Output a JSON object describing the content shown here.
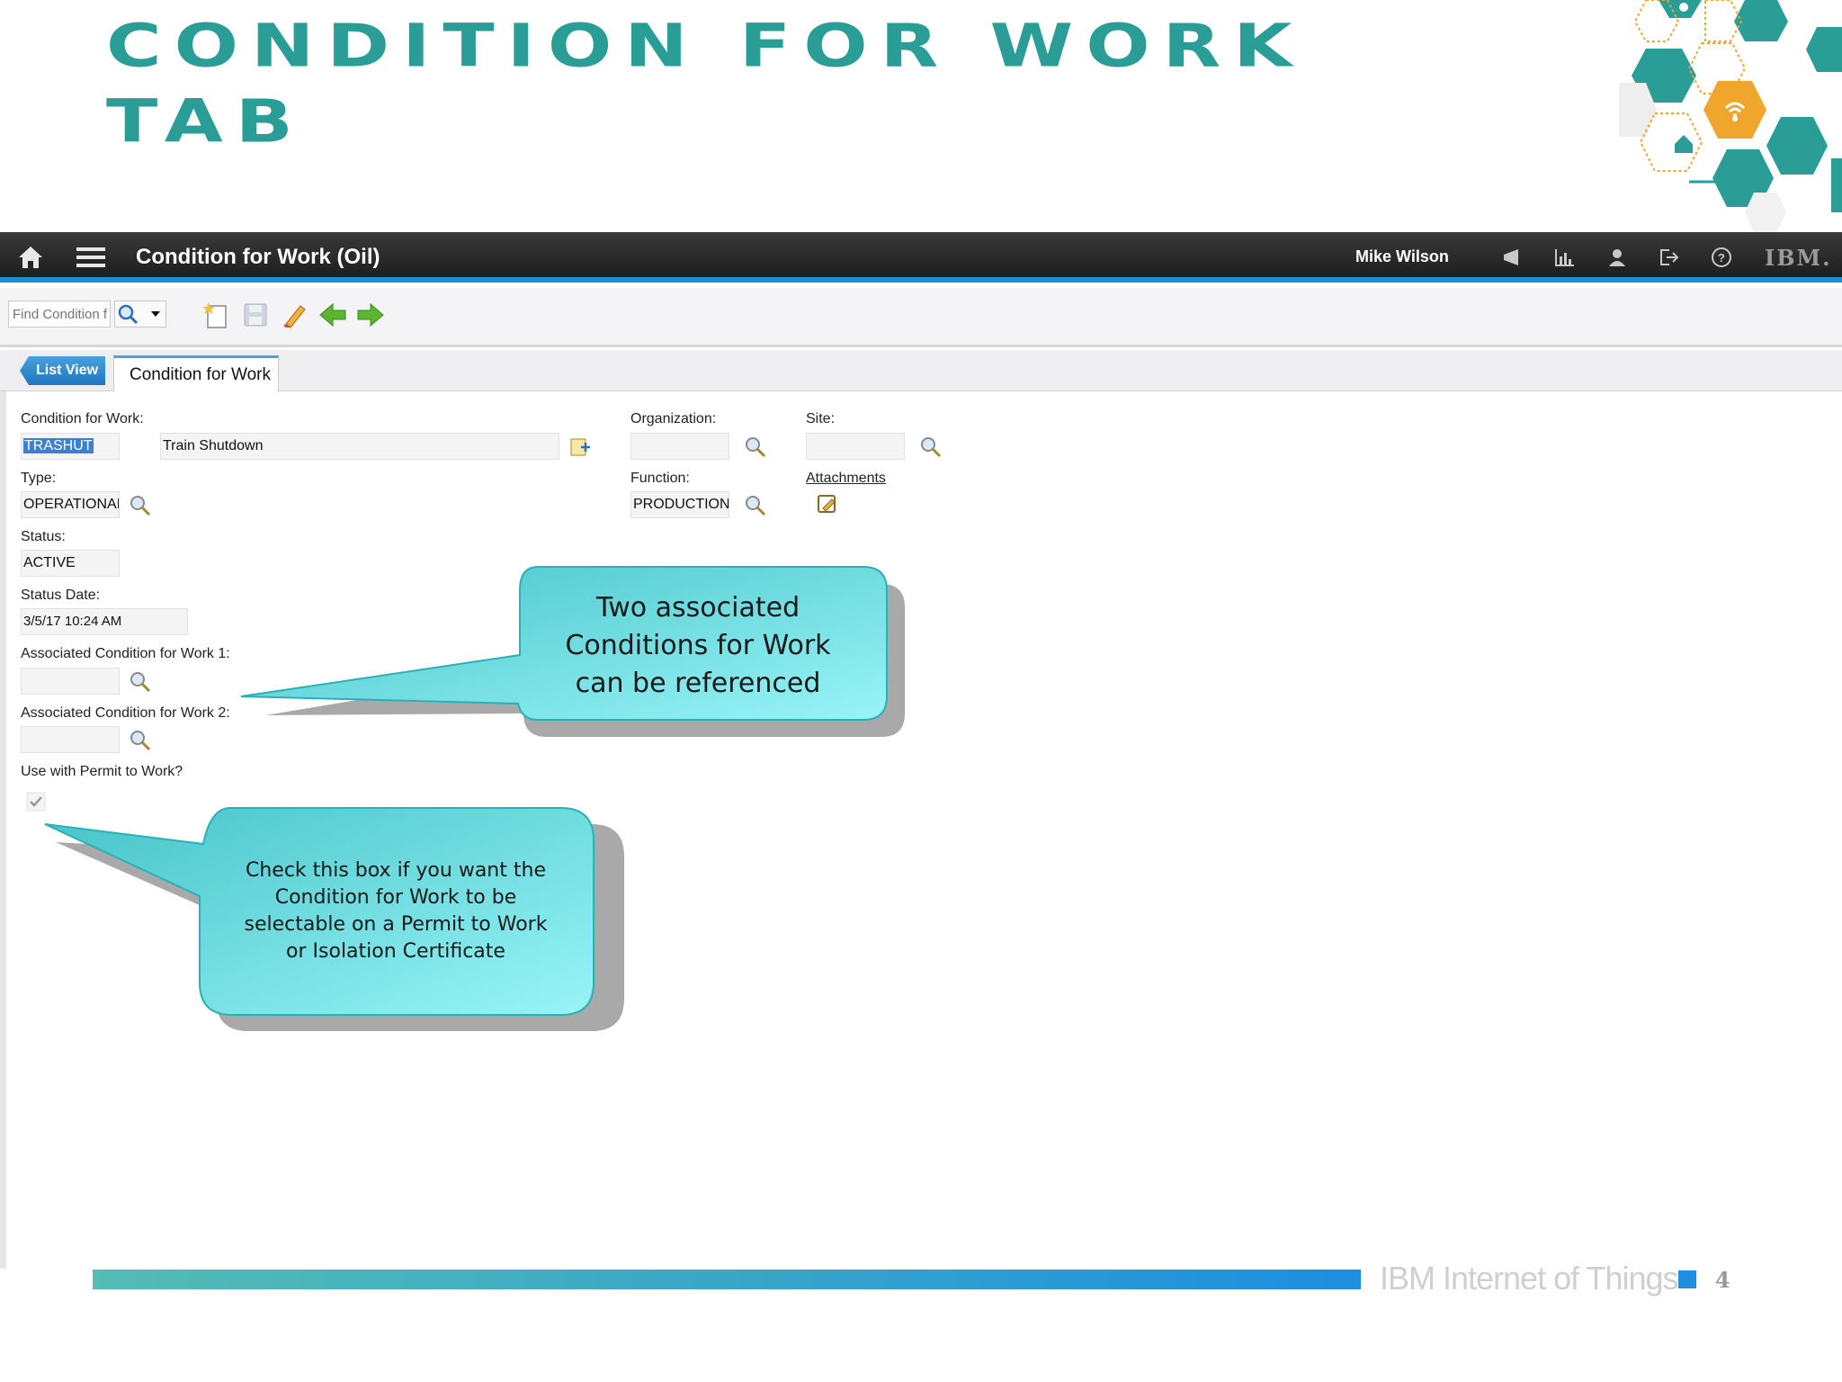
{
  "slide": {
    "title_line1": "Condition for Work",
    "title_line2": "Tab",
    "footer_text": "IBM Internet of Things",
    "page_number": "4"
  },
  "app": {
    "title": "Condition for Work (Oil)",
    "user": "Mike Wilson",
    "logo": "IBM.",
    "accent_color": "#1a8fd1"
  },
  "toolbar": {
    "find_placeholder": "Find Condition f",
    "icons": [
      "new-record-icon",
      "save-icon",
      "clear-changes-icon",
      "previous-record-icon",
      "next-record-icon"
    ]
  },
  "tabs": {
    "list_view": "List View",
    "condition_for_work": "Condition for Work"
  },
  "form": {
    "condition_for_work": {
      "label": "Condition for Work:",
      "value": "TRASHUT",
      "description": "Train Shutdown"
    },
    "type": {
      "label": "Type:",
      "value": "OPERATIONAL"
    },
    "status": {
      "label": "Status:",
      "value": "ACTIVE"
    },
    "status_date": {
      "label": "Status Date:",
      "value": "3/5/17 10:24 AM"
    },
    "assoc1": {
      "label": "Associated Condition for Work 1:",
      "value": ""
    },
    "assoc2": {
      "label": "Associated Condition for Work 2:",
      "value": ""
    },
    "permit": {
      "label": "Use with Permit to Work?",
      "checked": true
    },
    "organization": {
      "label": "Organization:",
      "value": ""
    },
    "site": {
      "label": "Site:",
      "value": ""
    },
    "function": {
      "label": "Function:",
      "value": "PRODUCTION"
    },
    "attachments": "Attachments"
  },
  "callouts": {
    "one": [
      "Two associated",
      "Conditions for Work",
      "can be referenced"
    ],
    "two": [
      "Check this box if you want the",
      "Condition for Work to be",
      "selectable on a Permit to Work",
      "or Isolation Certificate"
    ],
    "fill_color": "#5fd4d8"
  }
}
